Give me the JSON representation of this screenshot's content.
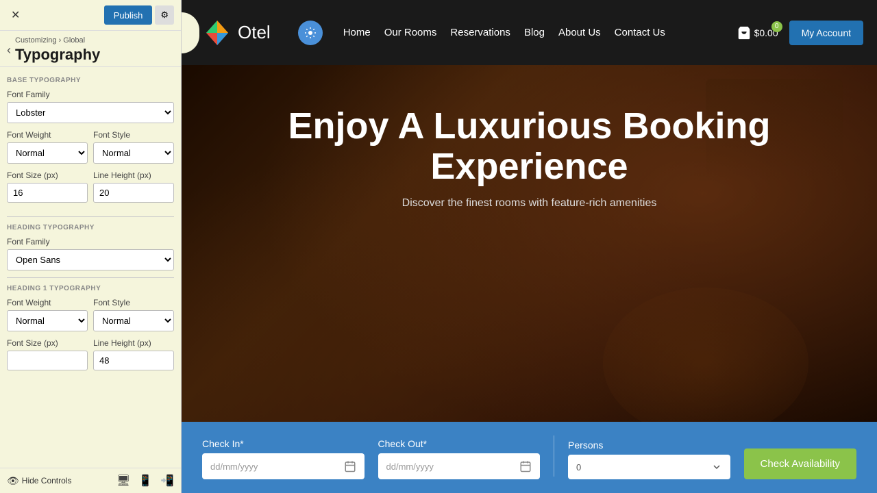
{
  "panel": {
    "close_label": "✕",
    "publish_label": "Publish",
    "settings_label": "⚙",
    "breadcrumb": "Customizing › Global",
    "page_title": "Typography",
    "back_label": "‹",
    "sections": {
      "base_typography_label": "BASE TYPOGRAPHY",
      "heading_typography_label": "HEADING TYPOGRAPHY",
      "heading1_typography_label": "HEADING 1 TYPOGRAPHY"
    },
    "base": {
      "font_family_label": "Font Family",
      "font_family_value": "Lobster",
      "font_weight_label": "Font Weight",
      "font_weight_value": "Normal",
      "font_style_label": "Font Style",
      "font_style_value": "Normal",
      "font_size_label": "Font Size (px)",
      "font_size_value": "16",
      "line_height_label": "Line Height (px)",
      "line_height_value": "20"
    },
    "heading": {
      "font_family_label": "Font Family",
      "font_family_value": "Open Sans"
    },
    "heading1": {
      "font_weight_label": "Font Weight",
      "font_weight_value": "Normal",
      "font_style_label": "Font Style",
      "font_style_value": "Normal",
      "font_size_label": "Font Size (px)",
      "font_size_value": "",
      "line_height_label": "Line Height (px)",
      "line_height_value": "48"
    },
    "footer": {
      "hide_controls_label": "Hide Controls"
    }
  },
  "navbar": {
    "logo_text": "Otel",
    "links": [
      "Home",
      "Our Rooms",
      "Reservations",
      "Blog",
      "About Us",
      "Contact Us"
    ],
    "cart_amount": "$0.00",
    "cart_badge": "0",
    "my_account_label": "My Account"
  },
  "hero": {
    "title": "Enjoy A Luxurious Booking Experience",
    "subtitle": "Discover the finest rooms with feature-rich amenities"
  },
  "booking": {
    "checkin_label": "Check In*",
    "checkin_placeholder": "dd/mm/yyyy",
    "checkout_label": "Check Out*",
    "checkout_placeholder": "dd/mm/yyyy",
    "persons_label": "Persons",
    "persons_value": "0",
    "check_btn_label": "Check Availability"
  }
}
